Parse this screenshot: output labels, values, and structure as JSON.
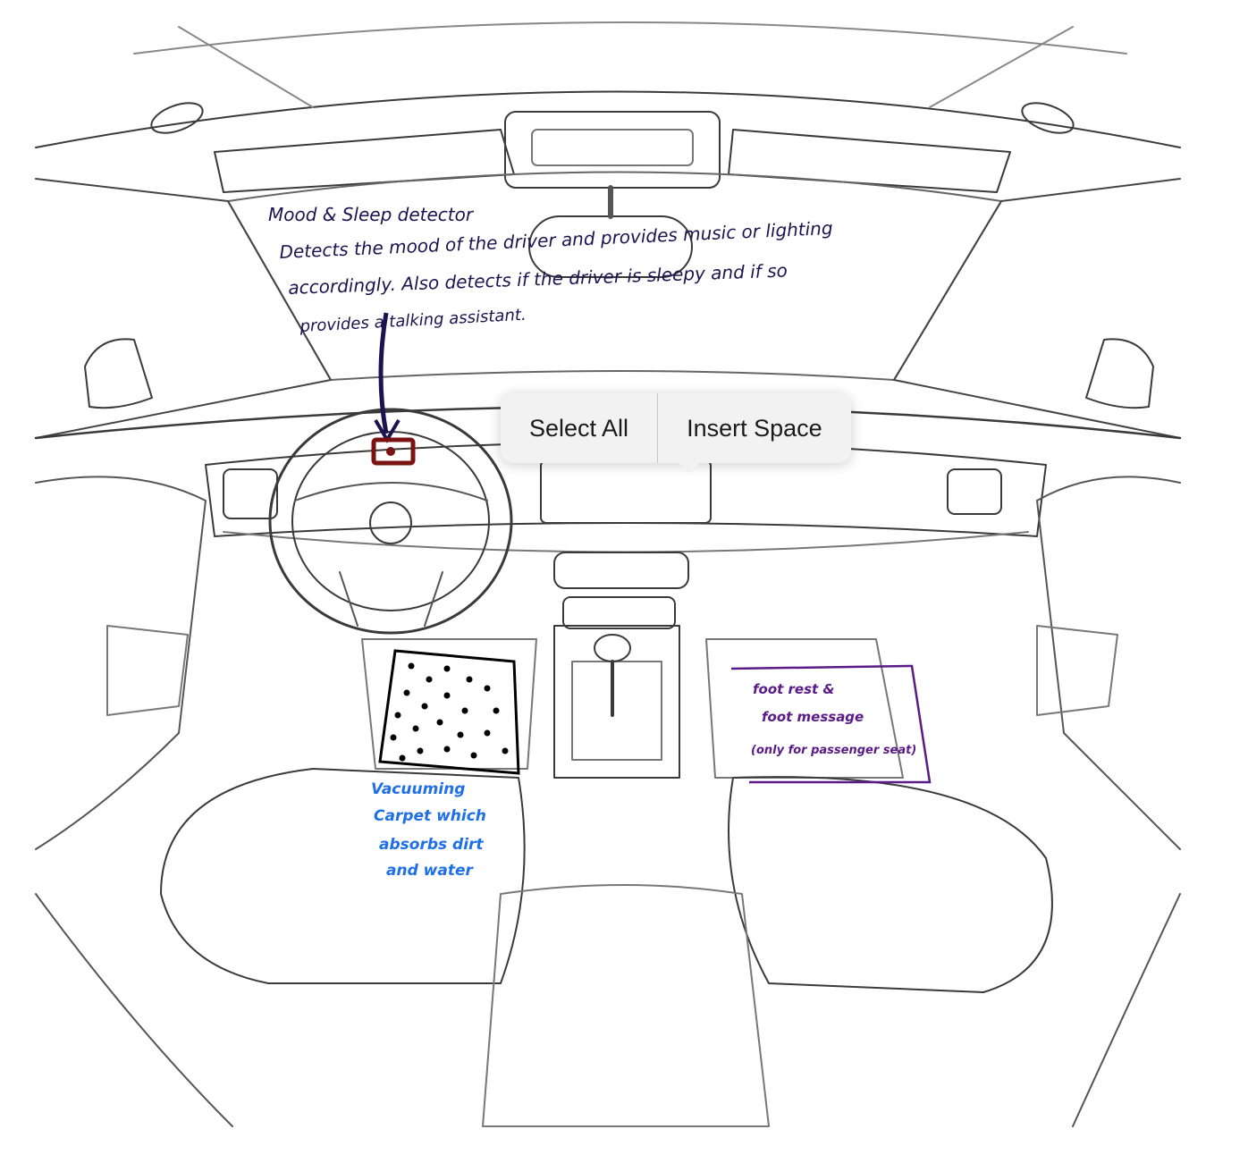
{
  "annotations": {
    "mood_title": "Mood & Sleep detector",
    "mood_desc_line1": "Detects the mood of the driver and provides music or lighting",
    "mood_desc_line2": "accordingly. Also detects if the driver is sleepy and if so",
    "mood_desc_line3": "provides a talking assistant.",
    "carpet_line1": "Vacuuming",
    "carpet_line2": "Carpet which",
    "carpet_line3": "absorbs dirt",
    "carpet_line4": "and water",
    "foot_line1": "foot rest &",
    "foot_line2": "foot message",
    "foot_line3": "(only for passenger seat)"
  },
  "context_menu": {
    "select_all": "Select All",
    "insert_space": "Insert Space"
  },
  "colors": {
    "ink_dark": "#1c1450",
    "ink_blue": "#1f6fe6",
    "ink_purple": "#5a1a87",
    "sensor_red": "#7a1212"
  }
}
